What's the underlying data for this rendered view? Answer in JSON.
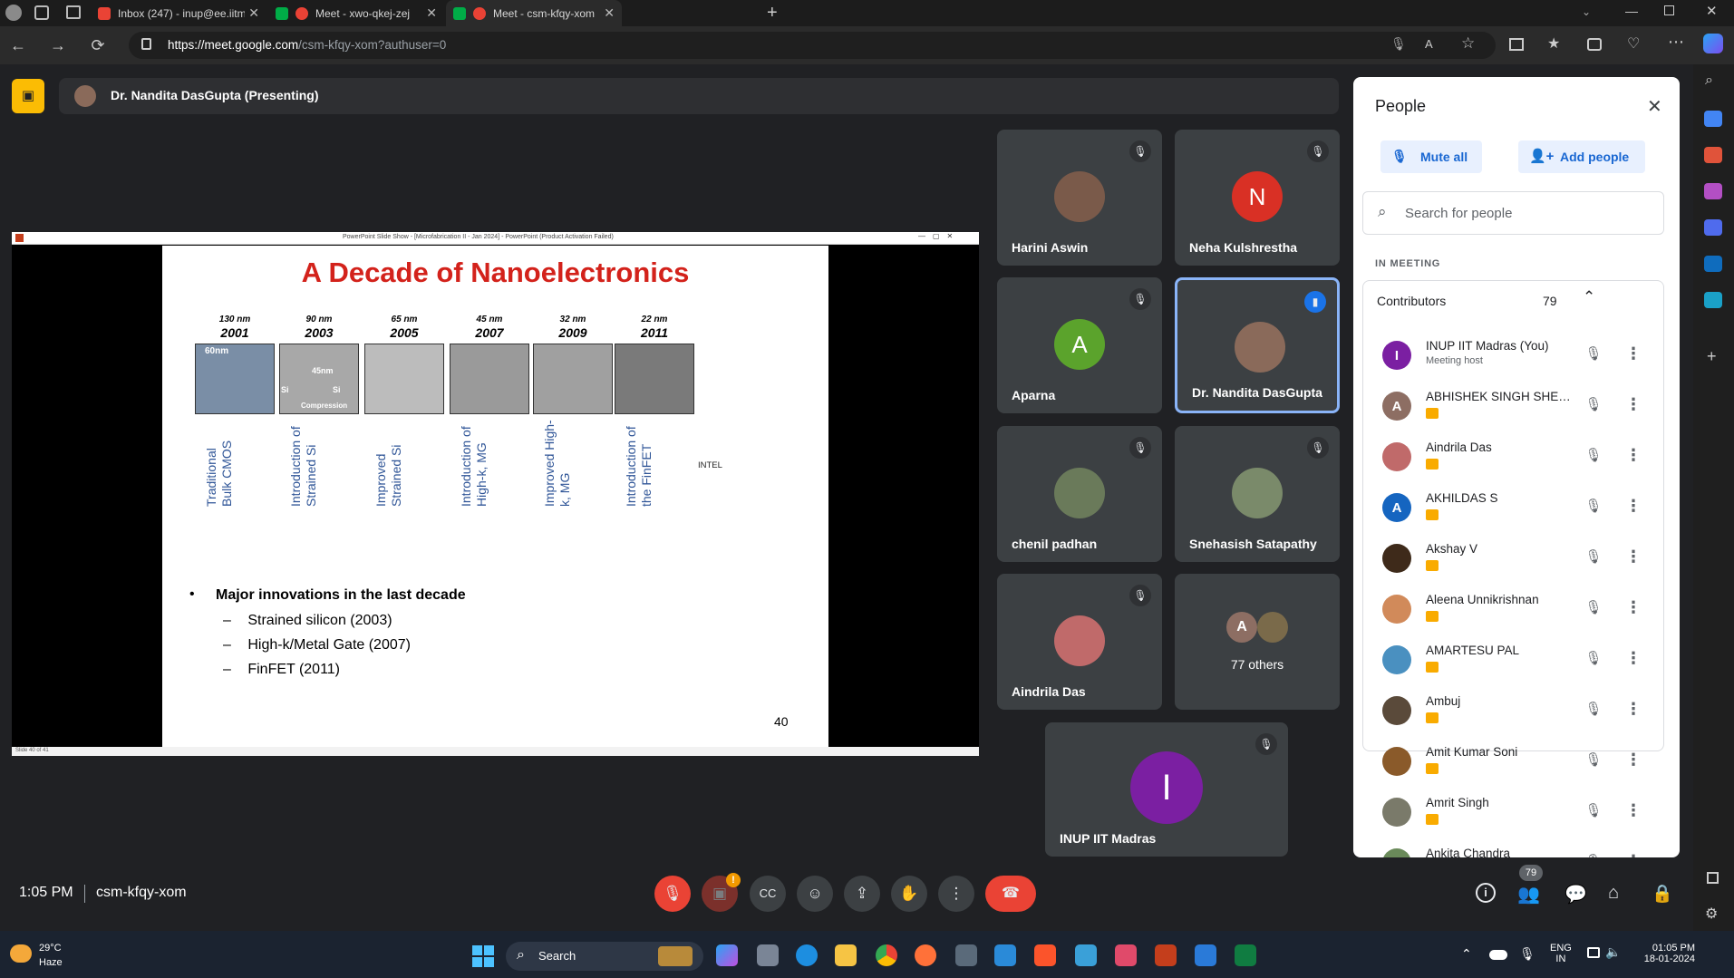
{
  "browser": {
    "tabs": [
      {
        "label": "Inbox (247) - inup@ee.iitm.ac.in"
      },
      {
        "label": "Meet - xwo-qkej-zej"
      },
      {
        "label": "Meet - csm-kfqy-xom"
      }
    ],
    "url_host": "https://meet.google.com",
    "url_path": "/csm-kfqy-xom?authuser=0"
  },
  "meet": {
    "presenter_label": "Dr. Nandita DasGupta (Presenting)",
    "slide": {
      "window_title": "PowerPoint Slide Show - [Microfabrication II - Jan 2024] - PowerPoint (Product Activation Failed)",
      "title": "A Decade of Nanoelectronics",
      "nodes": [
        {
          "nm": "130 nm",
          "year": "2001",
          "label": "Traditional\nBulk CMOS"
        },
        {
          "nm": "90 nm",
          "year": "2003",
          "label": "Introduction of\nStrained Si"
        },
        {
          "nm": "65 nm",
          "year": "2005",
          "label": "Improved\nStrained Si"
        },
        {
          "nm": "45 nm",
          "year": "2007",
          "label": "Introduction of\nHigh-k, MG"
        },
        {
          "nm": "32 nm",
          "year": "2009",
          "label": "Improved High-\nk, MG"
        },
        {
          "nm": "22 nm",
          "year": "2011",
          "label": "Introduction of\nthe FinFET"
        }
      ],
      "img_labels": {
        "a": "60nm",
        "b": "45nm",
        "c": "Compression",
        "d": "Si",
        "e": "Si",
        "intel": "INTEL"
      },
      "bullet": "Major innovations in the last decade",
      "subbullets": [
        "Strained silicon (2003)",
        "High-k/Metal Gate (2007)",
        "FinFET (2011)"
      ],
      "page_number": "40",
      "status": "Slide 40 of 41"
    },
    "tiles": [
      {
        "name": "Harini Aswin",
        "initial": "",
        "color": "#7a5a4a"
      },
      {
        "name": "Neha Kulshrestha",
        "initial": "N",
        "color": "#d93025"
      },
      {
        "name": "Aparna",
        "initial": "A",
        "color": "#5ba32c"
      },
      {
        "name": "Dr. Nandita DasGupta",
        "initial": "",
        "color": "#8a6a5a"
      },
      {
        "name": "chenil padhan",
        "initial": "",
        "color": "#6a7a5a"
      },
      {
        "name": "Snehasish Satapathy",
        "initial": "",
        "color": "#7a8a6a"
      },
      {
        "name": "Aindrila Das",
        "initial": "",
        "color": "#c06a6a"
      },
      {
        "name": "",
        "initial": "",
        "color": ""
      },
      {
        "name": "INUP IIT Madras",
        "initial": "I",
        "color": "#7b1fa2"
      }
    ],
    "others": {
      "initial": "A",
      "label": "77 others"
    },
    "time": "1:05 PM",
    "meeting_code": "csm-kfqy-xom",
    "participants_count": "79"
  },
  "people": {
    "title": "People",
    "mute_all": "Mute all",
    "add_people": "Add people",
    "search_placeholder": "Search for people",
    "section": "IN MEETING",
    "group_label": "Contributors",
    "group_count": "79",
    "rows": [
      {
        "name": "INUP IIT Madras (You)",
        "sub": "Meeting host",
        "initial": "I",
        "color": "#7b1fa2"
      },
      {
        "name": "ABHISHEK SINGH SHEK...",
        "sub": "",
        "initial": "A",
        "color": "#8d6e63"
      },
      {
        "name": "Aindrila Das",
        "sub": "",
        "initial": "",
        "color": "#c06a6a"
      },
      {
        "name": "AKHILDAS S",
        "sub": "",
        "initial": "A",
        "color": "#1565c0"
      },
      {
        "name": "Akshay V",
        "sub": "",
        "initial": "",
        "color": "#3e2a1a"
      },
      {
        "name": "Aleena Unnikrishnan",
        "sub": "",
        "initial": "",
        "color": "#d18a5a"
      },
      {
        "name": "AMARTESU PAL",
        "sub": "",
        "initial": "",
        "color": "#4a90c0"
      },
      {
        "name": "Ambuj",
        "sub": "",
        "initial": "",
        "color": "#5a4a3a"
      },
      {
        "name": "Amit Kumar Soni",
        "sub": "",
        "initial": "",
        "color": "#8a5a2a"
      },
      {
        "name": "Amrit Singh",
        "sub": "",
        "initial": "",
        "color": "#7a7a6a"
      },
      {
        "name": "Ankita Chandra",
        "sub": "",
        "initial": "",
        "color": "#6a8a5a"
      }
    ]
  },
  "taskbar": {
    "weather_temp": "29°C",
    "weather_desc": "Haze",
    "search": "Search",
    "lang1": "ENG",
    "lang2": "IN",
    "clock_time": "01:05 PM",
    "clock_date": "18-01-2024"
  }
}
